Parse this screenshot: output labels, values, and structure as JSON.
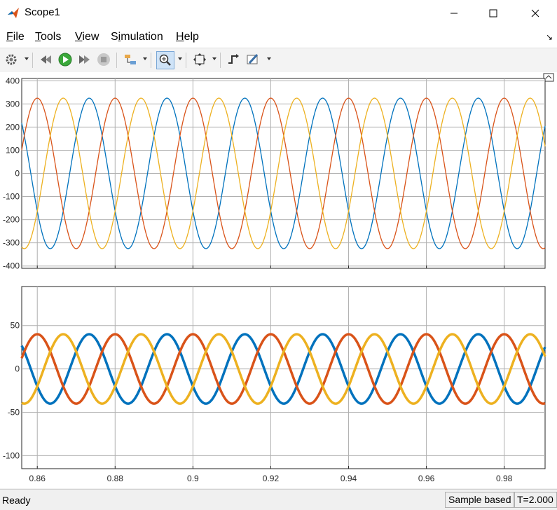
{
  "window": {
    "title": "Scope1"
  },
  "menu": [
    {
      "pre": "",
      "key": "F",
      "post": "ile"
    },
    {
      "pre": "",
      "key": "T",
      "post": "ools"
    },
    {
      "pre": "",
      "key": "V",
      "post": "iew"
    },
    {
      "pre": "S",
      "key": "i",
      "post": "mulation"
    },
    {
      "pre": "",
      "key": "H",
      "post": "elp"
    }
  ],
  "toolbar": [
    "settings-icon",
    "step-back-icon",
    "run-icon",
    "step-forward-icon",
    "stop-icon",
    "signal-hierarchy-icon",
    "zoom-in-icon",
    "autoscale-icon",
    "triggers-icon",
    "style-icon"
  ],
  "status": {
    "ready": "Ready",
    "mode": "Sample based",
    "time": "T=2.000"
  },
  "colors": {
    "phase_a": "#0072bd",
    "phase_b": "#d95319",
    "phase_c": "#edb120"
  },
  "chart_data": [
    {
      "type": "line",
      "title": "",
      "xlabel": "",
      "ylabel": "",
      "xlim": [
        0.856,
        0.9905
      ],
      "ylim": [
        -410,
        410
      ],
      "yticks": [
        -400,
        -300,
        -200,
        -100,
        0,
        100,
        200,
        300,
        400
      ],
      "grid": true,
      "frequency_hz": 50,
      "series": [
        {
          "amplitude": 325,
          "phase_deg": -150,
          "color": "#0072bd"
        },
        {
          "amplitude": 325,
          "phase_deg": 90,
          "color": "#d95319"
        },
        {
          "amplitude": 325,
          "phase_deg": -30,
          "color": "#edb120"
        }
      ]
    },
    {
      "type": "line",
      "title": "",
      "xlabel": "",
      "ylabel": "",
      "xlim": [
        0.856,
        0.9905
      ],
      "ylim": [
        -115,
        95
      ],
      "yticks": [
        -100,
        -50,
        0,
        50
      ],
      "xticks": [
        0.86,
        0.88,
        0.9,
        0.92,
        0.94,
        0.96,
        0.98
      ],
      "xtick_labels": [
        "0.86",
        "0.88",
        "0.9",
        "0.92",
        "0.94",
        "0.96",
        "0.98"
      ],
      "grid": true,
      "frequency_hz": 50,
      "series": [
        {
          "amplitude": 40,
          "phase_deg": -150,
          "color": "#0072bd"
        },
        {
          "amplitude": 40,
          "phase_deg": 90,
          "color": "#d95319"
        },
        {
          "amplitude": 40,
          "phase_deg": -30,
          "color": "#edb120"
        }
      ]
    }
  ]
}
